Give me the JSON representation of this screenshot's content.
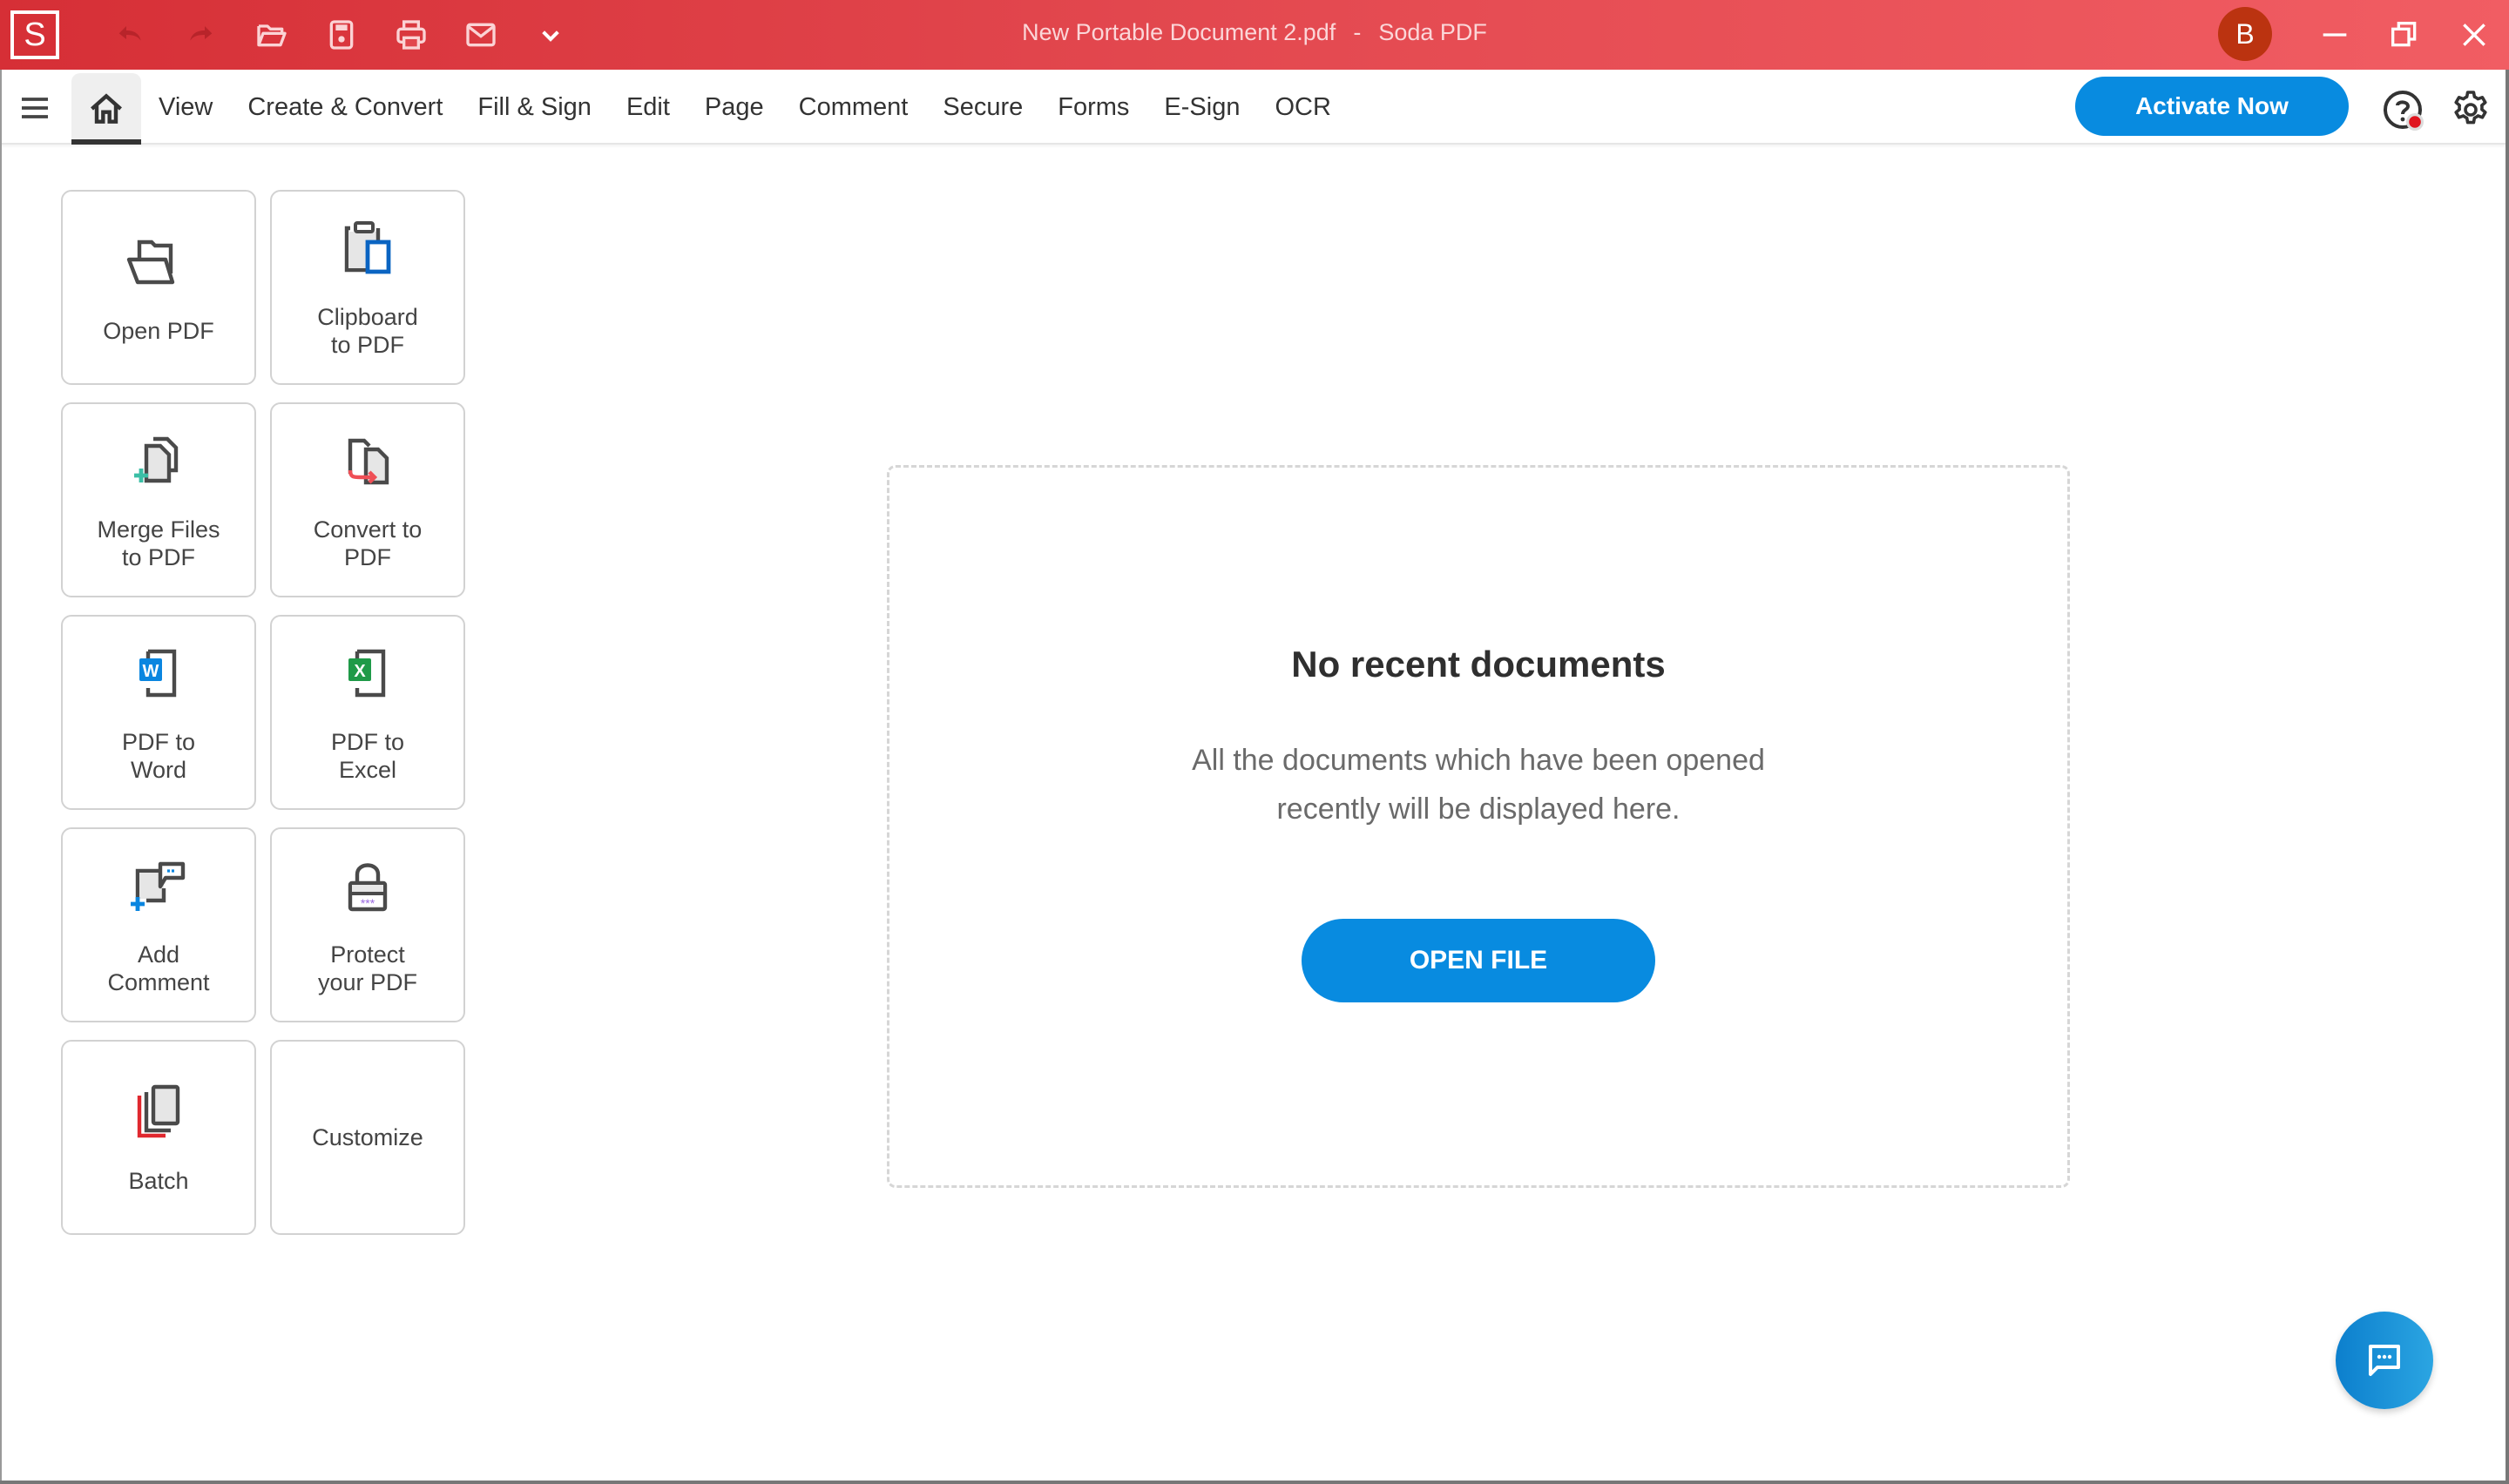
{
  "titlebar": {
    "app_logo": "S",
    "document_name": "New Portable Document 2.pdf",
    "separator": "-",
    "app_name": "Soda PDF",
    "avatar_initial": "B",
    "quick_access": [
      "undo-icon",
      "redo-icon",
      "open-folder-icon",
      "save-icon",
      "print-icon",
      "email-icon",
      "chevron-down-icon"
    ],
    "window_controls": [
      "minimize-icon",
      "restore-icon",
      "close-icon"
    ]
  },
  "menubar": {
    "items": [
      {
        "label": "View"
      },
      {
        "label": "Create & Convert"
      },
      {
        "label": "Fill & Sign"
      },
      {
        "label": "Edit"
      },
      {
        "label": "Page"
      },
      {
        "label": "Comment"
      },
      {
        "label": "Secure"
      },
      {
        "label": "Forms"
      },
      {
        "label": "E-Sign"
      },
      {
        "label": "OCR"
      }
    ],
    "active_tab": "home",
    "activate_label": "Activate Now"
  },
  "tiles": [
    {
      "label": "Open PDF",
      "icon": "open-folder-icon"
    },
    {
      "label": "Clipboard\nto PDF",
      "icon": "clipboard-icon"
    },
    {
      "label": "Merge Files\nto PDF",
      "icon": "merge-files-icon"
    },
    {
      "label": "Convert to\nPDF",
      "icon": "convert-icon"
    },
    {
      "label": "PDF to\nWord",
      "icon": "word-icon",
      "badge": "W"
    },
    {
      "label": "PDF to\nExcel",
      "icon": "excel-icon",
      "badge": "X"
    },
    {
      "label": "Add\nComment",
      "icon": "add-comment-icon"
    },
    {
      "label": "Protect\nyour PDF",
      "icon": "lock-icon",
      "badge": "***"
    },
    {
      "label": "Batch",
      "icon": "batch-icon"
    },
    {
      "label": "Customize"
    }
  ],
  "recent": {
    "title": "No recent documents",
    "description": "All the documents which have been opened recently will be displayed here.",
    "open_file_label": "OPEN FILE"
  },
  "colors": {
    "titlebar_red": "#d62f36",
    "accent_blue": "#088be0",
    "avatar": "#bb3310",
    "word_blue": "#0a86e0",
    "excel_green": "#1f9a48",
    "merge_plus": "#3bbfa6",
    "convert_arrow": "#ef4f56",
    "protect_stars": "#9a6ae0",
    "notification_dot": "#e0141e"
  }
}
